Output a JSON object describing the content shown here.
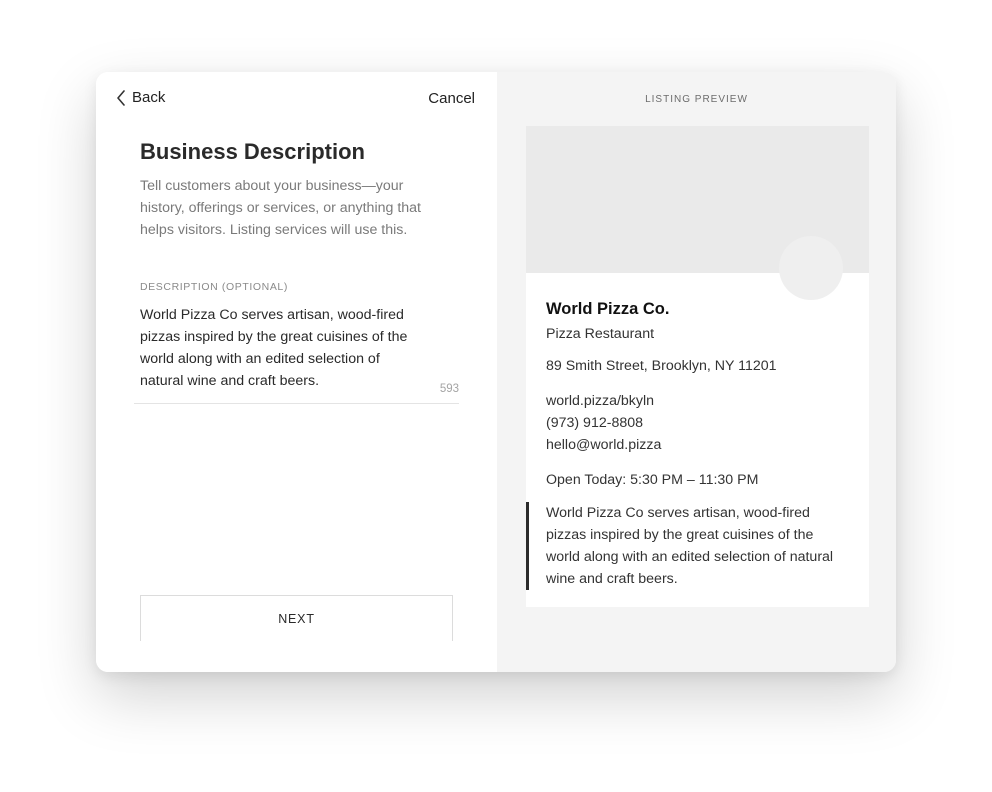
{
  "editor": {
    "back_label": "Back",
    "cancel_label": "Cancel",
    "title": "Business Description",
    "intro": "Tell customers about your business—your history, offerings or services, or anything that helps visitors. Listing services will use this.",
    "field_label": "DESCRIPTION (OPTIONAL)",
    "field_value": "World Pizza Co serves artisan, wood-fired pizzas inspired by the great cuisines of the world along with an edited selection of natural wine and craft beers.",
    "char_count": "593",
    "next_label": "NEXT"
  },
  "preview": {
    "label": "LISTING PREVIEW",
    "business_name": "World Pizza Co.",
    "category": "Pizza Restaurant",
    "address": "89 Smith Street, Brooklyn, NY 11201",
    "website": "world.pizza/bkyln",
    "phone": "(973) 912-8808",
    "email": "hello@world.pizza",
    "hours": "Open Today: 5:30 PM – 11:30 PM",
    "description": "World Pizza Co serves artisan, wood-fired pizzas inspired by the great cuisines of the world along with an edited selection of natural wine and craft beers."
  },
  "icons": {
    "back": "chevron-left-icon"
  },
  "colors": {
    "preview_bg": "#f4f4f4",
    "cover_placeholder": "#eaeaea",
    "accent_bar": "#2b2b2b"
  }
}
